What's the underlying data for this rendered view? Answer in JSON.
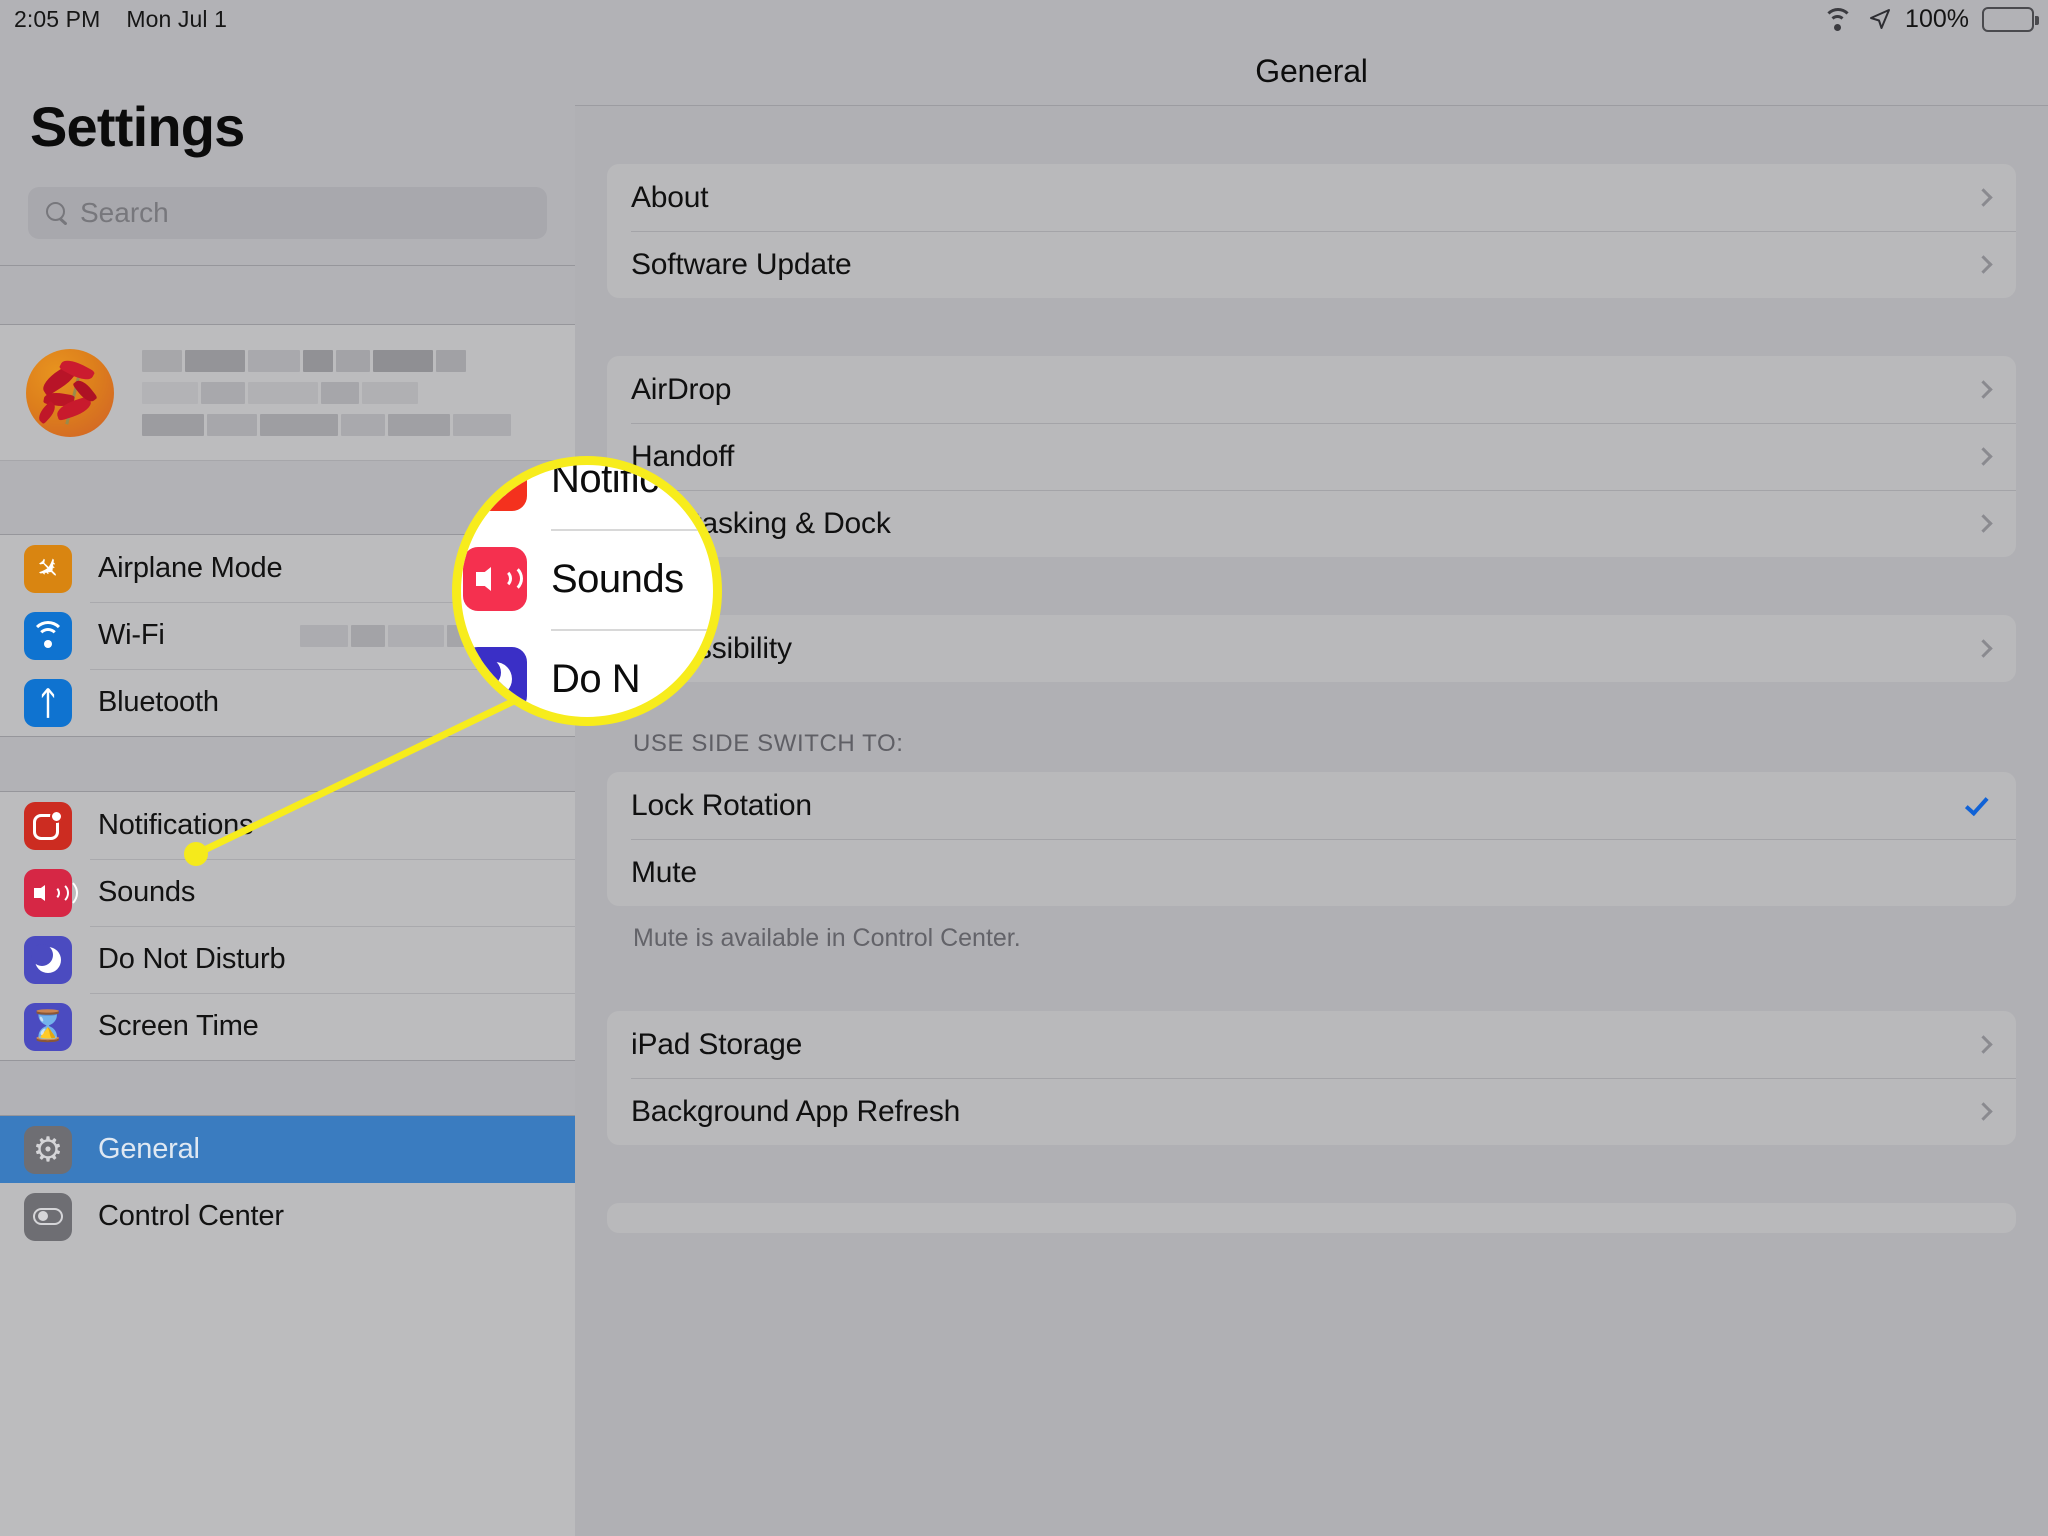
{
  "status_bar": {
    "time": "2:05 PM",
    "date": "Mon Jul 1",
    "wifi_icon": "wifi-icon",
    "location_icon": "location-arrow-icon",
    "battery_percent": "100%",
    "battery_icon": "battery-full-icon"
  },
  "sidebar": {
    "title": "Settings",
    "search": {
      "placeholder": "Search",
      "value": "",
      "icon": "search-icon"
    },
    "account": {
      "avatar_icon": "user-avatar-flower-image",
      "name_redacted": true,
      "subtitle_redacted": true
    },
    "groups": [
      {
        "items": [
          {
            "label": "Airplane Mode",
            "icon": "airplane-icon",
            "icon_color": "#d98511",
            "selected": false,
            "value": ""
          },
          {
            "label": "Wi-Fi",
            "icon": "wifi-icon",
            "icon_color": "#0f73d0",
            "selected": false,
            "value_redacted": true
          },
          {
            "label": "Bluetooth",
            "icon": "bluetooth-icon",
            "icon_color": "#0f73d0",
            "selected": false,
            "value": ""
          }
        ]
      },
      {
        "items": [
          {
            "label": "Notifications",
            "icon": "notifications-icon",
            "icon_color": "#cc2c21",
            "selected": false,
            "value": ""
          },
          {
            "label": "Sounds",
            "icon": "sounds-speaker-icon",
            "icon_color": "#d62745",
            "selected": false,
            "value": ""
          },
          {
            "label": "Do Not Disturb",
            "icon": "moon-icon",
            "icon_color": "#4b4bc0",
            "selected": false,
            "value": ""
          },
          {
            "label": "Screen Time",
            "icon": "hourglass-icon",
            "icon_color": "#4b4bc0",
            "selected": false,
            "value": ""
          }
        ]
      },
      {
        "items": [
          {
            "label": "General",
            "icon": "gear-icon",
            "icon_color": "#6e6e73",
            "selected": true,
            "value": ""
          },
          {
            "label": "Control Center",
            "icon": "toggle-icon",
            "icon_color": "#6e6e73",
            "selected": false,
            "value": ""
          }
        ]
      }
    ]
  },
  "detail": {
    "title": "General",
    "groups": [
      {
        "rows": [
          {
            "label": "About",
            "accessory": "chevron"
          },
          {
            "label": "Software Update",
            "accessory": "chevron"
          }
        ]
      },
      {
        "rows": [
          {
            "label": "AirDrop",
            "accessory": "chevron"
          },
          {
            "label": "Handoff",
            "accessory": "chevron"
          },
          {
            "label": "Multitasking & Dock",
            "accessory": "chevron"
          }
        ]
      },
      {
        "rows": [
          {
            "label": "Accessibility",
            "accessory": "chevron"
          }
        ]
      },
      {
        "header": "USE SIDE SWITCH TO:",
        "footer": "Mute is available in Control Center.",
        "rows": [
          {
            "label": "Lock Rotation",
            "accessory": "checkmark"
          },
          {
            "label": "Mute",
            "accessory": "none"
          }
        ]
      },
      {
        "rows": [
          {
            "label": "iPad Storage",
            "accessory": "chevron"
          },
          {
            "label": "Background App Refresh",
            "accessory": "chevron"
          }
        ]
      }
    ]
  },
  "callout": {
    "target_label": "Sounds",
    "highlight_color": "#f7ec1c",
    "magnified_rows": [
      {
        "label": "Notific",
        "icon": "notifications-icon",
        "icon_color": "#f4311e"
      },
      {
        "label": "Sounds",
        "icon": "sounds-speaker-icon",
        "icon_color": "#f5304f"
      },
      {
        "label": "Do N",
        "icon": "moon-icon",
        "icon_color": "#3a2fc6"
      }
    ]
  },
  "colors": {
    "accent_blue": "#3a7cc0",
    "checkmark_blue": "#1062d6",
    "callout_yellow": "#f7ec1c",
    "panel_bg": "#b0b0b4",
    "sidebar_bg": "#bcbcbe",
    "card_bg": "#b9b9bb"
  }
}
